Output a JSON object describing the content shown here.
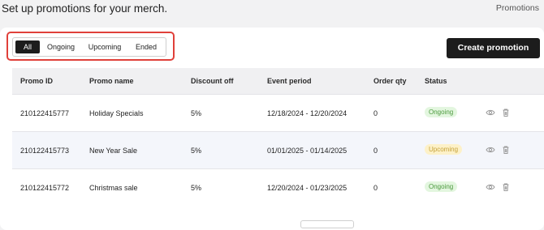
{
  "header": {
    "title": "Set up promotions for your merch.",
    "breadcrumb": "Promotions"
  },
  "tabs": [
    {
      "label": "All",
      "active": true
    },
    {
      "label": "Ongoing",
      "active": false
    },
    {
      "label": "Upcoming",
      "active": false
    },
    {
      "label": "Ended",
      "active": false
    }
  ],
  "actions": {
    "create_label": "Create promotion"
  },
  "table": {
    "columns": [
      "Promo ID",
      "Promo name",
      "Discount off",
      "Event period",
      "Order qty",
      "Status"
    ],
    "rows": [
      {
        "id": "210122415777",
        "name": "Holiday Specials",
        "discount": "5%",
        "period": "12/18/2024 - 12/20/2024",
        "qty": "0",
        "status": "Ongoing"
      },
      {
        "id": "210122415773",
        "name": "New Year Sale",
        "discount": "5%",
        "period": "01/01/2025 - 01/14/2025",
        "qty": "0",
        "status": "Upcoming"
      },
      {
        "id": "210122415772",
        "name": "Christmas sale",
        "discount": "5%",
        "period": "12/20/2024 - 01/23/2025",
        "qty": "0",
        "status": "Ongoing"
      }
    ]
  },
  "colors": {
    "highlight": "#e0403a",
    "ongoing_bg": "#e3f6df",
    "ongoing_text": "#4c9a3e",
    "upcoming_bg": "#fdf1c8",
    "upcoming_text": "#c5a23a"
  },
  "icons": [
    "eye-icon",
    "trash-icon"
  ]
}
